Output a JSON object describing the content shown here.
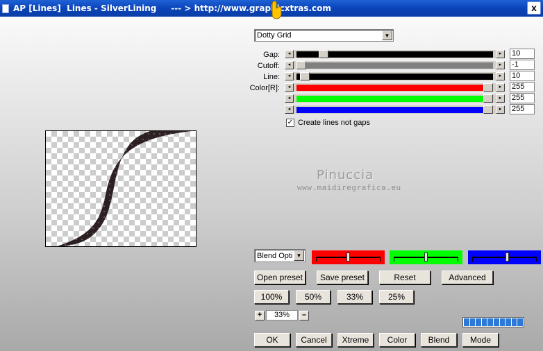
{
  "window": {
    "title": "AP [Lines]  Lines - SilverLining     --- > http://www.graphicxtras.com",
    "close_glyph": "x"
  },
  "effect_select": {
    "value": "Dotty Grid"
  },
  "params": [
    {
      "label": "Gap:",
      "value": "10"
    },
    {
      "label": "Cutoff:",
      "value": "-1"
    },
    {
      "label": "Line:",
      "value": "10"
    },
    {
      "label": "Color[R]:",
      "value": "255"
    },
    {
      "label": "",
      "value": "255"
    },
    {
      "label": "",
      "value": "255"
    }
  ],
  "create_lines_checkbox": {
    "label": "Create lines not gaps",
    "checked": true
  },
  "watermark": {
    "name": "Pinuccia",
    "url": "www.maidiregrafica.eu"
  },
  "blend_select": {
    "value": "Blend Opti"
  },
  "color_boxes": {
    "red": "#ff0000",
    "green": "#00ff00",
    "blue": "#0000ff"
  },
  "buttons_row1": {
    "open_preset": "Open preset",
    "save_preset": "Save preset",
    "reset": "Reset",
    "advanced": "Advanced"
  },
  "zoom_buttons": {
    "z100": "100%",
    "z50": "50%",
    "z33": "33%",
    "z25": "25%"
  },
  "zoom": {
    "plus": "+",
    "value": "33%",
    "minus": "–"
  },
  "bottom_buttons": {
    "ok": "OK",
    "cancel": "Cancel",
    "xtreme": "Xtreme",
    "color": "Color",
    "blend": "Blend",
    "mode": "Mode"
  },
  "progress_segments": 10,
  "slider_levels": {
    "gap": 0.12,
    "cutoff": 0.0,
    "line": 0.02,
    "red": 1.0,
    "green": 1.0,
    "blue": 1.0
  },
  "color_box_levels": {
    "red": 0.5,
    "green": 0.5,
    "blue": 0.55
  },
  "shape_fill": "#2c2022",
  "accent_title": "#0b44b8"
}
